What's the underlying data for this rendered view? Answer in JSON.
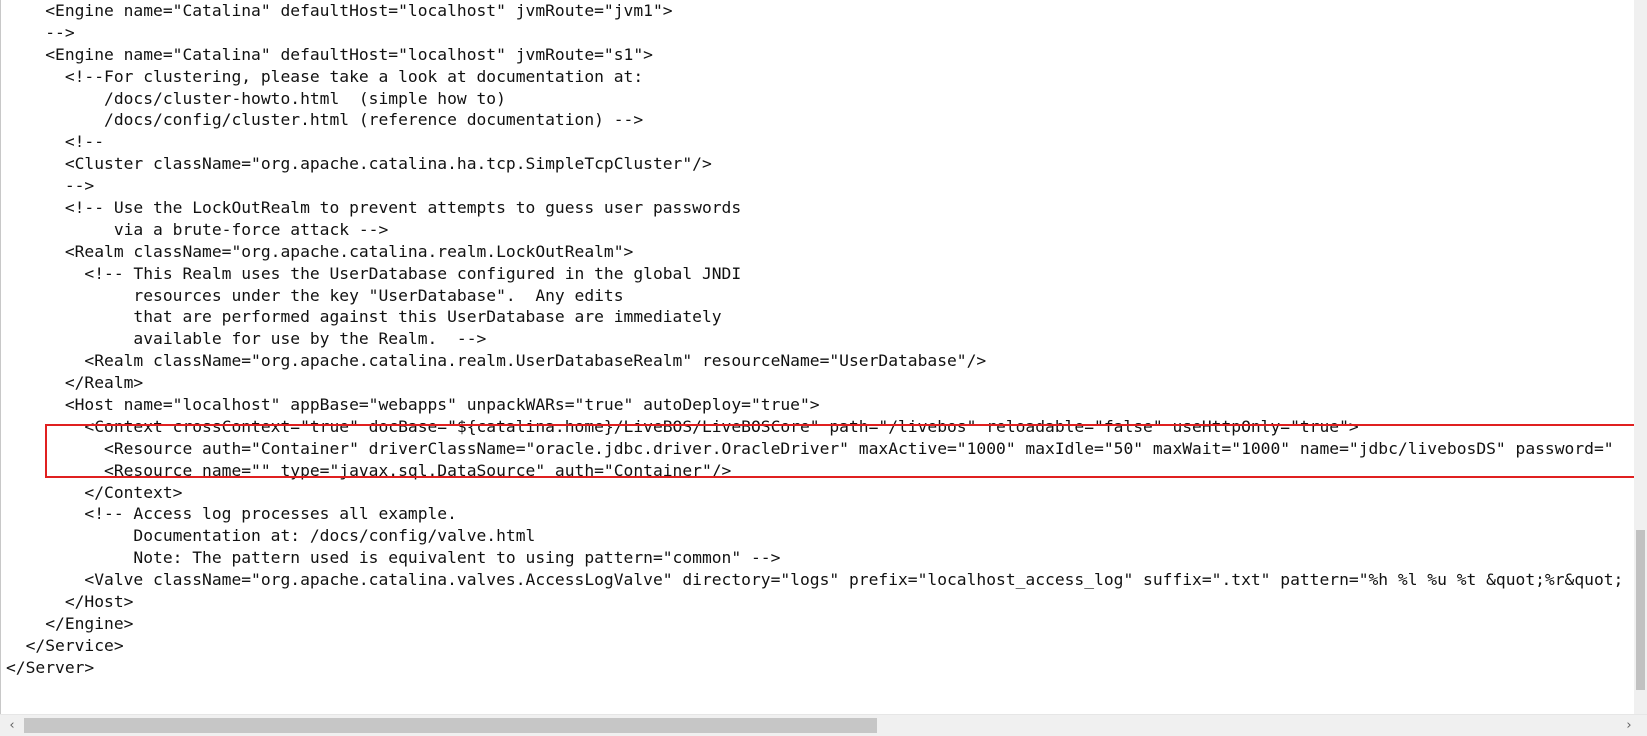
{
  "editor": {
    "lines": [
      "    <Engine name=\"Catalina\" defaultHost=\"localhost\" jvmRoute=\"jvm1\">",
      "    -->",
      "    <Engine name=\"Catalina\" defaultHost=\"localhost\" jvmRoute=\"s1\">",
      "      <!--For clustering, please take a look at documentation at:",
      "          /docs/cluster-howto.html  (simple how to)",
      "          /docs/config/cluster.html (reference documentation) -->",
      "      <!--",
      "      <Cluster className=\"org.apache.catalina.ha.tcp.SimpleTcpCluster\"/>",
      "      -->",
      "      <!-- Use the LockOutRealm to prevent attempts to guess user passwords",
      "           via a brute-force attack -->",
      "      <Realm className=\"org.apache.catalina.realm.LockOutRealm\">",
      "        <!-- This Realm uses the UserDatabase configured in the global JNDI",
      "             resources under the key \"UserDatabase\".  Any edits",
      "             that are performed against this UserDatabase are immediately",
      "             available for use by the Realm.  -->",
      "        <Realm className=\"org.apache.catalina.realm.UserDatabaseRealm\" resourceName=\"UserDatabase\"/>",
      "      </Realm>",
      "      <Host name=\"localhost\" appBase=\"webapps\" unpackWARs=\"true\" autoDeploy=\"true\">",
      "        <Context crossContext=\"true\" docBase=\"${catalina.home}/LiveBOS/LiveBOSCore\" path=\"/livebos\" reloadable=\"false\" useHttpOnly=\"true\">",
      "          <Resource auth=\"Container\" driverClassName=\"oracle.jdbc.driver.OracleDriver\" maxActive=\"1000\" maxIdle=\"50\" maxWait=\"1000\" name=\"jdbc/livebosDS\" password=\"",
      "          <Resource name=\"\" type=\"javax.sql.DataSource\" auth=\"Container\"/>",
      "        </Context>",
      "        <!-- Access log processes all example.",
      "             Documentation at: /docs/config/valve.html",
      "             Note: The pattern used is equivalent to using pattern=\"common\" -->",
      "        <Valve className=\"org.apache.catalina.valves.AccessLogValve\" directory=\"logs\" prefix=\"localhost_access_log\" suffix=\".txt\" pattern=\"%h %l %u %t &quot;%r&quot;",
      "      </Host>",
      "    </Engine>",
      "  </Service>",
      "</Server>"
    ]
  },
  "scrollbar": {
    "left_arrow_icon": "chevron-left-icon",
    "right_arrow_icon": "chevron-right-icon",
    "left_arrow_glyph": "‹",
    "right_arrow_glyph": "›"
  },
  "colors": {
    "highlight_border": "#e02020",
    "text": "#111111",
    "background": "#ffffff"
  }
}
